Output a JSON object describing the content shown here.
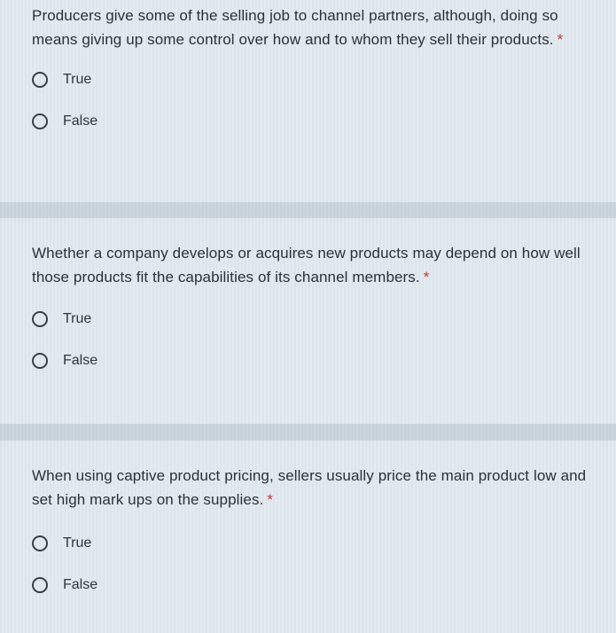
{
  "questions": [
    {
      "text": "Producers give some of the selling job to channel partners, although, doing so means giving up some control over how and to whom they sell their products.",
      "required_mark": "*",
      "options": [
        "True",
        "False"
      ]
    },
    {
      "text": "Whether a company develops or acquires new products may depend on how well those products fit the capabilities of its channel members.",
      "required_mark": "*",
      "options": [
        "True",
        "False"
      ]
    },
    {
      "text": "When using captive product pricing, sellers usually price the main product low and set high mark ups on the supplies.",
      "required_mark": "*",
      "options": [
        "True",
        "False"
      ]
    }
  ]
}
